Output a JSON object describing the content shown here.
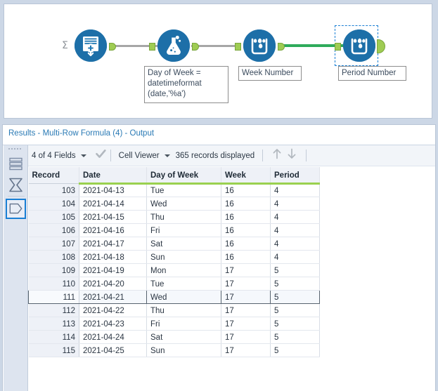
{
  "canvas": {
    "tools": [
      {
        "id": "generate-rows",
        "icon": "generate-rows-icon",
        "label": "",
        "prefix_symbol": "∑"
      },
      {
        "id": "formula",
        "icon": "formula-flask-icon",
        "label": "Day of Week =\ndatetimeformat\n(date,'%a')"
      },
      {
        "id": "multi-row-formula-week",
        "icon": "multi-row-formula-icon",
        "label": "Week Number"
      },
      {
        "id": "multi-row-formula-period",
        "icon": "multi-row-formula-icon",
        "label": "Period Number",
        "selected": true
      }
    ]
  },
  "results": {
    "title": "Results - Multi-Row Formula (4) - Output",
    "toolbar": {
      "fields_label": "4 of 4 Fields",
      "check_icon": "checkmark-icon",
      "viewer_label": "Cell Viewer",
      "records_label": "365 records displayed",
      "prev_icon": "arrow-up-icon",
      "next_icon": "arrow-down-icon"
    },
    "rail": {
      "items": [
        {
          "name": "data-list-icon",
          "selected": false
        },
        {
          "name": "sigma-profile-icon",
          "selected": false
        },
        {
          "name": "metadata-tag-icon",
          "selected": true
        }
      ]
    },
    "grid": {
      "columns": [
        "Record",
        "Date",
        "Day of Week",
        "Week",
        "Period"
      ],
      "selected_record": "111",
      "rows": [
        {
          "record": "103",
          "date": "2021-04-13",
          "dow": "Tue",
          "week": "16",
          "period": "4"
        },
        {
          "record": "104",
          "date": "2021-04-14",
          "dow": "Wed",
          "week": "16",
          "period": "4"
        },
        {
          "record": "105",
          "date": "2021-04-15",
          "dow": "Thu",
          "week": "16",
          "period": "4"
        },
        {
          "record": "106",
          "date": "2021-04-16",
          "dow": "Fri",
          "week": "16",
          "period": "4"
        },
        {
          "record": "107",
          "date": "2021-04-17",
          "dow": "Sat",
          "week": "16",
          "period": "4"
        },
        {
          "record": "108",
          "date": "2021-04-18",
          "dow": "Sun",
          "week": "16",
          "period": "4"
        },
        {
          "record": "109",
          "date": "2021-04-19",
          "dow": "Mon",
          "week": "17",
          "period": "5"
        },
        {
          "record": "110",
          "date": "2021-04-20",
          "dow": "Tue",
          "week": "17",
          "period": "5"
        },
        {
          "record": "111",
          "date": "2021-04-21",
          "dow": "Wed",
          "week": "17",
          "period": "5"
        },
        {
          "record": "112",
          "date": "2021-04-22",
          "dow": "Thu",
          "week": "17",
          "period": "5"
        },
        {
          "record": "113",
          "date": "2021-04-23",
          "dow": "Fri",
          "week": "17",
          "period": "5"
        },
        {
          "record": "114",
          "date": "2021-04-24",
          "dow": "Sat",
          "week": "17",
          "period": "5"
        },
        {
          "record": "115",
          "date": "2021-04-25",
          "dow": "Sun",
          "week": "17",
          "period": "5"
        }
      ]
    }
  },
  "colors": {
    "tool_blue": "#1d6fa8",
    "anchor_green": "#9fcc53",
    "wire_grey": "#a6a6a6",
    "wire_selected_green": "#2eab5b",
    "header_underline_green": "#9ad14f",
    "title_blue": "#2a7ab5",
    "selection_blue": "#1a7fd4"
  }
}
